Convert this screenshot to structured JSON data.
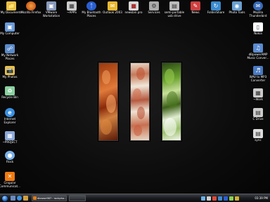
{
  "desktop": {
    "top_icons": [
      {
        "label": "My Documents",
        "icon": "folder-icon",
        "color": "#e8c04a"
      },
      {
        "label": "Mozilla Firefox",
        "icon": "firefox-icon",
        "color": "#e8702a"
      },
      {
        "label": "VMware Workstation",
        "icon": "vmware-icon",
        "color": "#8899bb"
      },
      {
        "label": "~APPS",
        "icon": "shortcut-icon",
        "color": "#cccccc"
      },
      {
        "label": "My Bluetooth Places",
        "icon": "bluetooth-icon",
        "color": "#2a5fd0"
      },
      {
        "label": "Outlook 2003",
        "icon": "outlook-icon",
        "color": "#e8b830"
      },
      {
        "label": "newsbin pro",
        "icon": "newsbin-icon",
        "color": "#d8d8d8"
      },
      {
        "label": "Services",
        "icon": "services-icon",
        "color": "#aaaaaa"
      },
      {
        "label": "semi-portable usb drive",
        "icon": "usb-drive-icon",
        "color": "#bbbbbb"
      },
      {
        "label": "News",
        "icon": "news-icon",
        "color": "#d04040"
      },
      {
        "label": "FolderShare",
        "icon": "foldershare-icon",
        "color": "#3a8ad0"
      },
      {
        "label": "Photo Tools",
        "icon": "photo-tools-icon",
        "color": "#6aa0d0"
      },
      {
        "label": "Mozilla Thunderbird",
        "icon": "thunderbird-icon",
        "color": "#3a6ab8"
      }
    ],
    "left_icons": [
      {
        "label": "My Computer",
        "icon": "computer-icon",
        "color": "#6a9ad8"
      },
      {
        "label": "My Network Places",
        "icon": "network-icon",
        "color": "#5a8ac8"
      },
      {
        "label": "My Photos",
        "icon": "photos-icon",
        "color": "#e8c04a"
      },
      {
        "label": "Recycle Bin",
        "icon": "recycle-bin-icon",
        "color": "#8ad0a0"
      },
      {
        "label": "Internet Explorer",
        "icon": "ie-icon",
        "color": "#3a90e0"
      },
      {
        "label": "~PROJECT",
        "icon": "project-icon",
        "color": "#8aa8d8"
      },
      {
        "label": "Flock",
        "icon": "flock-icon",
        "color": "#7ab0e8"
      },
      {
        "label": "Cingular Communicat...",
        "icon": "cingular-icon",
        "color": "#f07a10"
      }
    ],
    "right_icons": [
      {
        "label": "Nokia",
        "icon": "nokia-icon",
        "color": "#ffffff"
      },
      {
        "label": "dBpowerAMP Music Conver...",
        "icon": "dbpoweramp-icon",
        "color": "#5a8ad0"
      },
      {
        "label": "WAV to MP3 Converter",
        "icon": "wav-mp3-icon",
        "color": "#4a7ac0"
      },
      {
        "label": "~Work",
        "icon": "work-icon",
        "color": "#cccccc"
      },
      {
        "label": "C Drive",
        "icon": "drive-icon",
        "color": "#cccccc"
      },
      {
        "label": "sync",
        "icon": "sync-icon",
        "color": "#dddddd"
      }
    ]
  },
  "taskbar": {
    "buttons": [
      {
        "label": "dbrown987 : rockpho..."
      }
    ],
    "clock": "03:39 PM"
  }
}
